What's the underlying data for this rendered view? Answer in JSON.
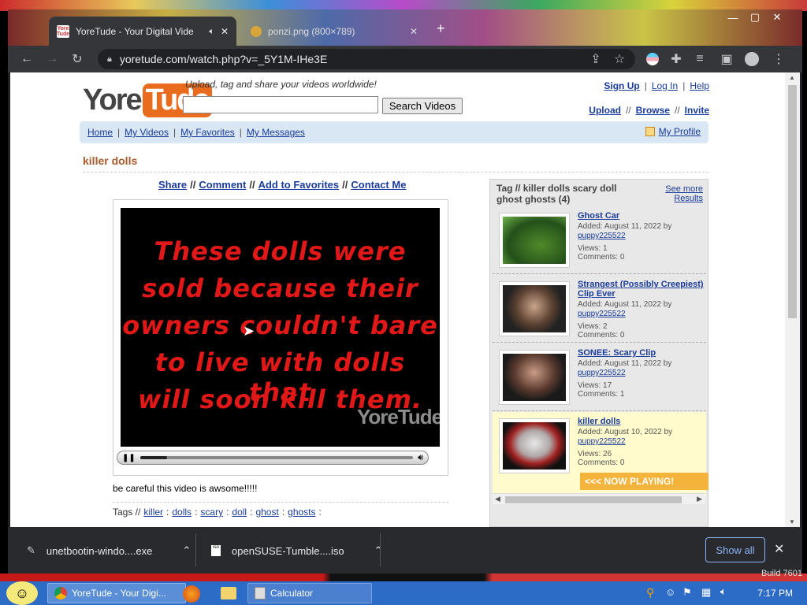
{
  "browser": {
    "tabs": [
      {
        "title": "YoreTude - Your Digital Vide",
        "favicon": "YoreTude"
      },
      {
        "title": "ponzi.png (800×789)"
      }
    ],
    "url": "yoretude.com/watch.php?v=_5Y1M-IHe3E"
  },
  "site": {
    "logo_a": "Yore",
    "logo_b": "Tude",
    "tagline": "Upload, tag and share your videos worldwide!",
    "search_placeholder": "",
    "search_button": "Search Videos",
    "toplinks1": [
      "Sign Up",
      "Log In",
      "Help"
    ],
    "toplinks2": [
      "Upload",
      "Browse",
      "Invite"
    ],
    "sep1": "|",
    "sep2": "//",
    "nav": [
      "Home",
      "My Videos",
      "My Favorites",
      "My Messages"
    ],
    "profile": "My Profile"
  },
  "video": {
    "title": "killer dolls",
    "actions": [
      "Share",
      "Comment",
      "Add to Favorites",
      "Contact Me"
    ],
    "caption_lines": [
      "These dolls were",
      "sold because their",
      "owners couldn't bare",
      "to live with dolls that",
      "will soon kill them."
    ],
    "watermark": "YoreTude",
    "progress": 0.1,
    "description": "be careful this video is awsome!!!!!",
    "tags_label": "Tags //",
    "tags": [
      "killer",
      "dolls",
      "scary",
      "doll",
      "ghost",
      "ghosts"
    ]
  },
  "sidebar": {
    "heading": "Tag // killer dolls scary doll ghost ghosts (4)",
    "see_more": "See more",
    "results": "Results",
    "items": [
      {
        "title": "Ghost Car",
        "added": "Added: August 11, 2022 by",
        "user": "puppy225522",
        "views": "Views: 1",
        "comments": "Comments: 0"
      },
      {
        "title": "Strangest (Possibly Creepiest) Clip Ever",
        "added": "Added: August 11, 2022 by",
        "user": "puppy225522",
        "views": "Views: 2",
        "comments": "Comments: 0"
      },
      {
        "title": "SONEE: Scary Clip",
        "added": "Added: August 11, 2022 by",
        "user": "puppy225522",
        "views": "Views: 17",
        "comments": "Comments: 1"
      },
      {
        "title": "killer dolls",
        "added": "Added: August 10, 2022 by",
        "user": "puppy225522",
        "views": "Views: 26",
        "comments": "Comments: 0"
      }
    ],
    "now_playing": "<<< NOW PLAYING!"
  },
  "downloads": {
    "items": [
      "unetbootin-windo....exe",
      "openSUSE-Tumble....iso"
    ],
    "show_all": "Show all"
  },
  "taskbar": {
    "buttons": [
      "YoreTude - Your Digi...",
      "Calculator"
    ],
    "clock": "7:17 PM",
    "build": "Build 7601"
  }
}
